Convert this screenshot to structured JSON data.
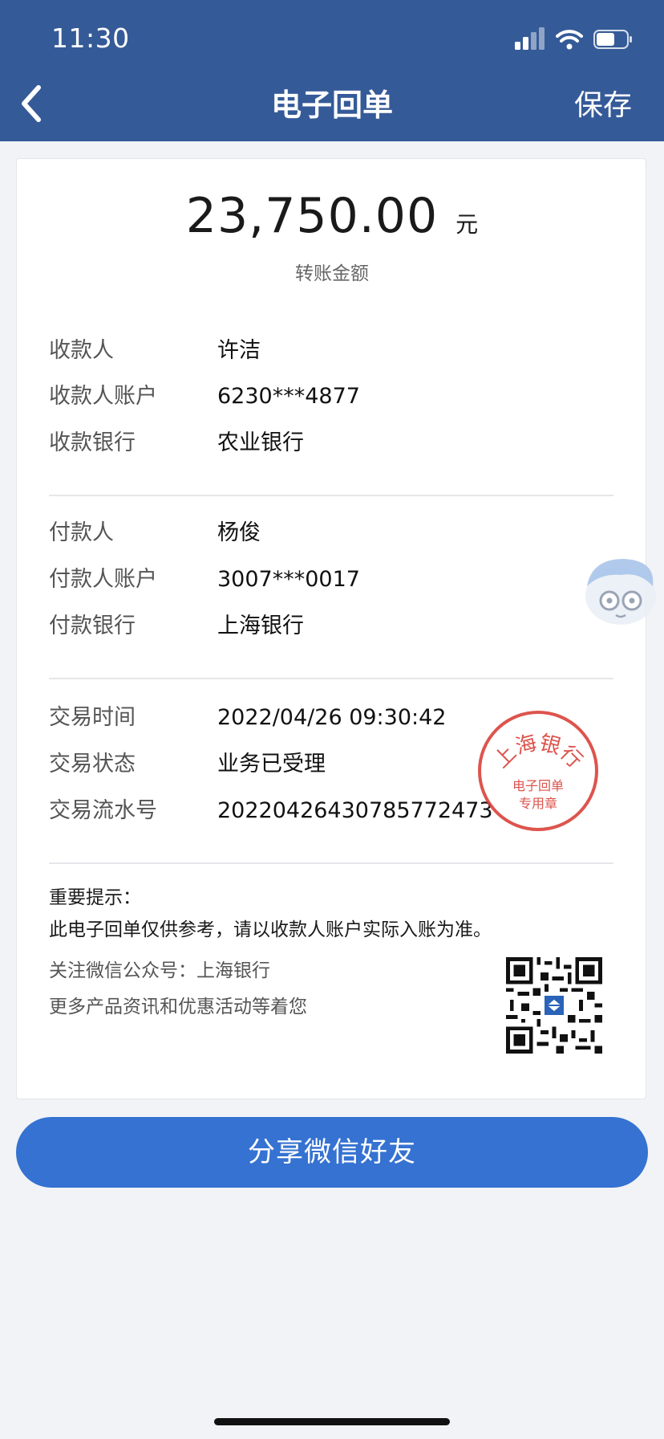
{
  "status_bar": {
    "time": "11:30"
  },
  "nav": {
    "title": "电子回单",
    "save_label": "保存"
  },
  "amount": {
    "value": "23,750.00",
    "unit": "元",
    "label": "转账金额"
  },
  "payee": [
    {
      "label": "收款人",
      "value": "许洁"
    },
    {
      "label": "收款人账户",
      "value": "6230***4877"
    },
    {
      "label": "收款银行",
      "value": "农业银行"
    }
  ],
  "payer": [
    {
      "label": "付款人",
      "value": "杨俊"
    },
    {
      "label": "付款人账户",
      "value": "3007***0017"
    },
    {
      "label": "付款银行",
      "value": "上海银行"
    }
  ],
  "transaction": [
    {
      "label": "交易时间",
      "value": "2022/04/26 09:30:42"
    },
    {
      "label": "交易状态",
      "value": "业务已受理"
    },
    {
      "label": "交易流水号",
      "value": "20220426430785772473"
    }
  ],
  "stamp": {
    "top_text": "上海银行",
    "line1": "电子回单",
    "line2": "专用章",
    "color": "#d9413a"
  },
  "notice": {
    "title": "重要提示：",
    "text": "此电子回单仅供参考，请以收款人账户实际入账为准。",
    "follow_line1": "关注微信公众号：上海银行",
    "follow_line2": "更多产品资讯和优惠活动等着您"
  },
  "share_button": {
    "label": "分享微信好友"
  },
  "colors": {
    "header": "#355a98",
    "button": "#3572d1",
    "background": "#f2f3f6"
  }
}
